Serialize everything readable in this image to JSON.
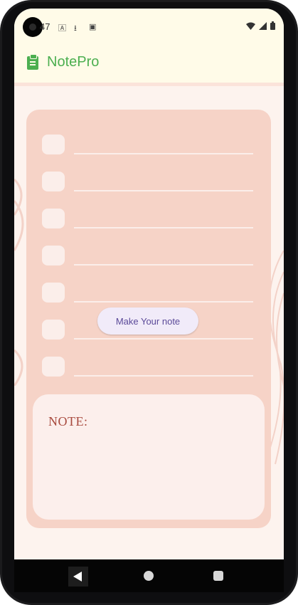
{
  "status_bar": {
    "time": "47",
    "icons": [
      "notification-a-icon",
      "download-icon",
      "sim-icon",
      "wifi-icon",
      "signal-icon",
      "battery-icon"
    ]
  },
  "app_bar": {
    "title": "NotePro",
    "icon": "clipboard-icon",
    "accent_color": "#4caf50"
  },
  "checklist": {
    "rows": 7
  },
  "button": {
    "label": "Make Your note"
  },
  "note": {
    "label": "NOTE:"
  },
  "nav_bar": {
    "items": [
      "back-icon",
      "home-icon",
      "recents-icon"
    ]
  }
}
